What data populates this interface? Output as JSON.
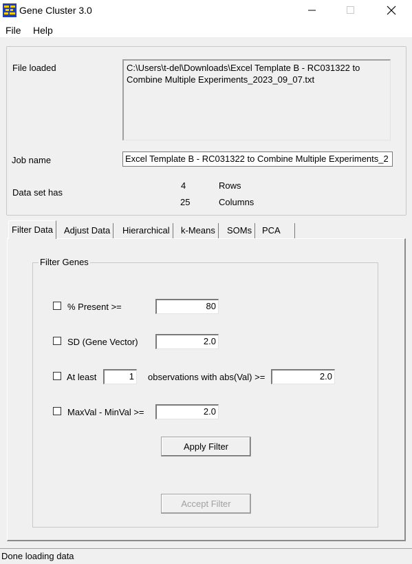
{
  "window": {
    "title": "Gene Cluster 3.0",
    "minimize_icon": "minimize-icon",
    "maximize_icon": "maximize-icon",
    "close_icon": "close-icon"
  },
  "menu": {
    "items": [
      {
        "label": "File"
      },
      {
        "label": "Help"
      }
    ]
  },
  "file_info": {
    "file_loaded_label": "File loaded",
    "file_path_line1": "C:\\Users\\t-del\\Downloads\\Excel Template B - RC031322 to",
    "file_path_line2": "Combine Multiple Experiments_2023_09_07.txt",
    "job_name_label": "Job name",
    "job_name_value": "Excel Template B - RC031322 to Combine Multiple Experiments_2",
    "dataset_label": "Data set has",
    "rows_count": "4",
    "rows_label": "Rows",
    "columns_count": "25",
    "columns_label": "Columns"
  },
  "tabs": [
    {
      "label": "Filter Data",
      "active": true
    },
    {
      "label": "Adjust Data",
      "active": false
    },
    {
      "label": "Hierarchical",
      "active": false
    },
    {
      "label": "k-Means",
      "active": false
    },
    {
      "label": "SOMs",
      "active": false
    },
    {
      "label": "PCA",
      "active": false
    }
  ],
  "filter_genes": {
    "group_label": "Filter Genes",
    "present_label": "% Present >=",
    "present_value": "80",
    "present_checked": false,
    "sd_label": "SD (Gene Vector)",
    "sd_value": "2.0",
    "sd_checked": false,
    "atleast_label": "At least",
    "atleast_count": "1",
    "atleast_obs_label": "observations with abs(Val) >=",
    "atleast_value": "2.0",
    "atleast_checked": false,
    "maxmin_label": "MaxVal - MinVal >=",
    "maxmin_value": "2.0",
    "maxmin_checked": false,
    "apply_button": "Apply Filter",
    "accept_button": "Accept Filter"
  },
  "status": {
    "text": "Done loading data"
  },
  "colors": {
    "window_bg": "#f0f0f0",
    "titlebar_bg": "#ffffff",
    "disabled_text": "#a0a0a0"
  }
}
